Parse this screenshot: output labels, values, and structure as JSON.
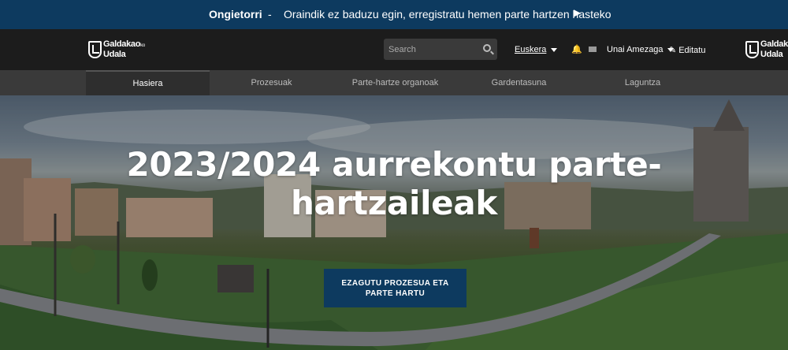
{
  "banner": {
    "title": "Ongietorri",
    "separator": "-",
    "message": "Oraindik ez baduzu egin, erregistratu hemen parte hartzen hasteko",
    "arrow_icon": "play-arrow-icon",
    "bg_color": "#0d3a5f"
  },
  "header": {
    "logo_line1": "Galdakao",
    "logo_suffix": "ko",
    "logo_line2": "Udala",
    "search_placeholder": "Search",
    "language": "Euskera",
    "user_name": "Unai Amezaga",
    "edit_label": "Editatu"
  },
  "nav": {
    "items": [
      {
        "label": "Hasiera",
        "active": true
      },
      {
        "label": "Prozesuak",
        "active": false
      },
      {
        "label": "Parte-hartze organoak",
        "active": false
      },
      {
        "label": "Gardentasuna",
        "active": false
      },
      {
        "label": "Laguntza",
        "active": false
      }
    ]
  },
  "hero": {
    "title": "2023/2024 aurrekontu parte-hartzaileak",
    "cta_line1": "EZAGUTU PROZESUA ETA",
    "cta_line2": "PARTE HARTU"
  }
}
